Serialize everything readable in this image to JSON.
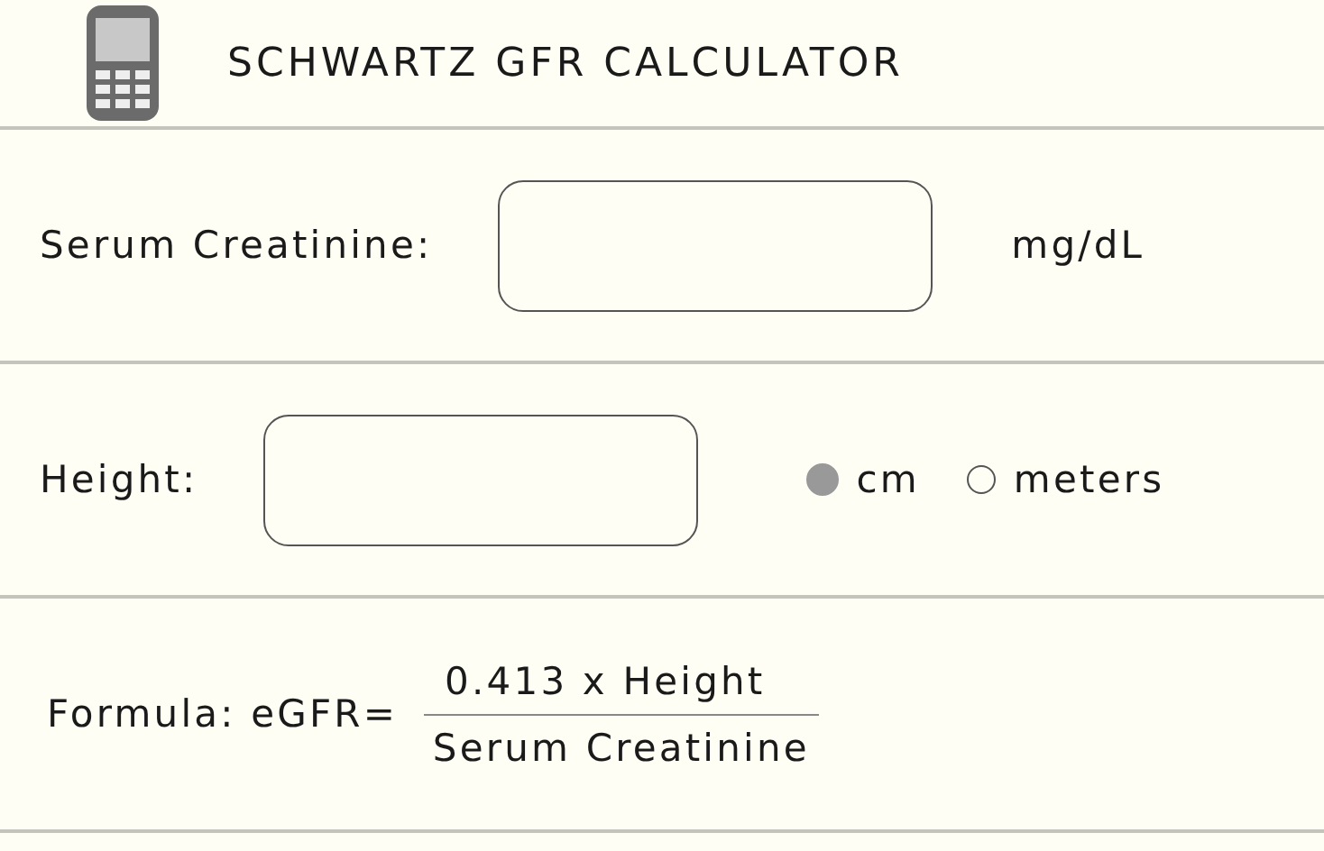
{
  "header": {
    "title": "SCHWARTZ GFR CALCULATOR"
  },
  "fields": [
    {
      "label": "Serum Creatinine:",
      "kind": "unit",
      "unit": "mg/dL"
    },
    {
      "label": "Height:",
      "kind": "radio",
      "options": [
        {
          "label": "cm",
          "selected": true
        },
        {
          "label": "meters",
          "selected": false
        }
      ]
    }
  ],
  "formula": {
    "label": "Formula: eGFR=",
    "numerator": "0.413 x Height",
    "denominator": "Serum Creatinine"
  }
}
